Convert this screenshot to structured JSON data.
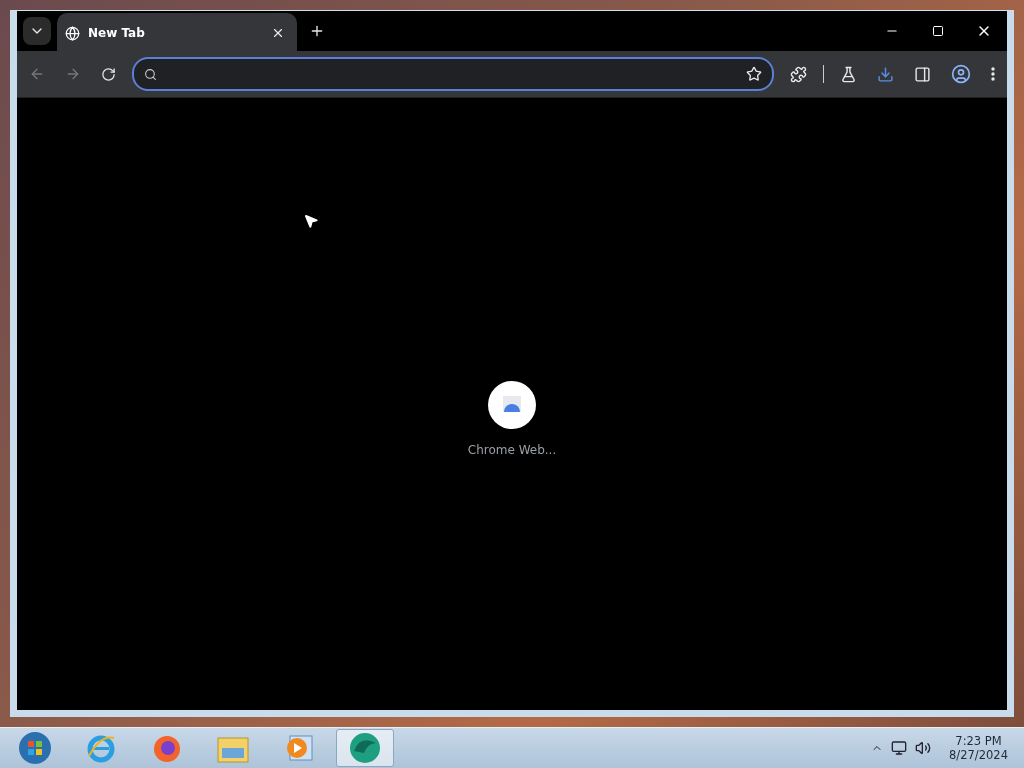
{
  "browser": {
    "tabs": [
      {
        "title": "New Tab",
        "selected": true
      }
    ],
    "omnibox": {
      "focused": true
    },
    "downloads_active": true
  },
  "shortcuts": [
    {
      "label": "Chrome Web..."
    }
  ],
  "taskbar": {
    "items": [
      {
        "kind": "start",
        "selected": false
      },
      {
        "kind": "ie",
        "selected": false
      },
      {
        "kind": "firefox",
        "selected": false
      },
      {
        "kind": "folder",
        "selected": false
      },
      {
        "kind": "media",
        "selected": false
      },
      {
        "kind": "app",
        "selected": true
      }
    ],
    "clock": {
      "time": "7:23 PM",
      "date": "8/27/2024"
    }
  }
}
